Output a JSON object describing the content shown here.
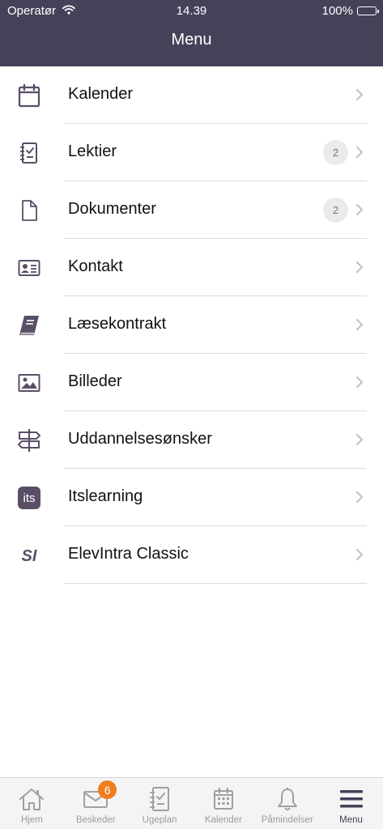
{
  "status_bar": {
    "carrier": "Operatør",
    "time": "14.39",
    "battery": "100%",
    "battery_level_percent": 100
  },
  "header": {
    "title": "Menu"
  },
  "colors": {
    "header_bg": "#474059",
    "icon_purple": "#5a4e67",
    "badge_orange": "#f07d1e",
    "tab_inactive": "#9b9b9b",
    "tab_active": "#474059"
  },
  "menu": {
    "items": [
      {
        "label": "Kalender",
        "icon": "calendar-icon"
      },
      {
        "label": "Lektier",
        "icon": "homework-checklist-icon",
        "badge": "2"
      },
      {
        "label": "Dokumenter",
        "icon": "document-icon",
        "badge": "2"
      },
      {
        "label": "Kontakt",
        "icon": "contact-card-icon"
      },
      {
        "label": "Læsekontrakt",
        "icon": "book-icon"
      },
      {
        "label": "Billeder",
        "icon": "image-icon"
      },
      {
        "label": "Uddannelsesønsker",
        "icon": "signpost-icon"
      },
      {
        "label": "Itslearning",
        "icon": "itslearning-logo-icon",
        "logo_text": "its"
      },
      {
        "label": "ElevIntra Classic",
        "icon": "elevintra-logo-icon",
        "logo_text": "SI"
      }
    ]
  },
  "tabbar": {
    "tabs": [
      {
        "label": "Hjem",
        "icon": "home-icon"
      },
      {
        "label": "Beskeder",
        "icon": "envelope-icon",
        "badge": "6"
      },
      {
        "label": "Ugeplan",
        "icon": "weekplan-checklist-icon"
      },
      {
        "label": "Kalender",
        "icon": "calendar-grid-icon"
      },
      {
        "label": "Påmindelser",
        "icon": "bell-icon"
      },
      {
        "label": "Menu",
        "icon": "hamburger-menu-icon",
        "active": true
      }
    ]
  }
}
